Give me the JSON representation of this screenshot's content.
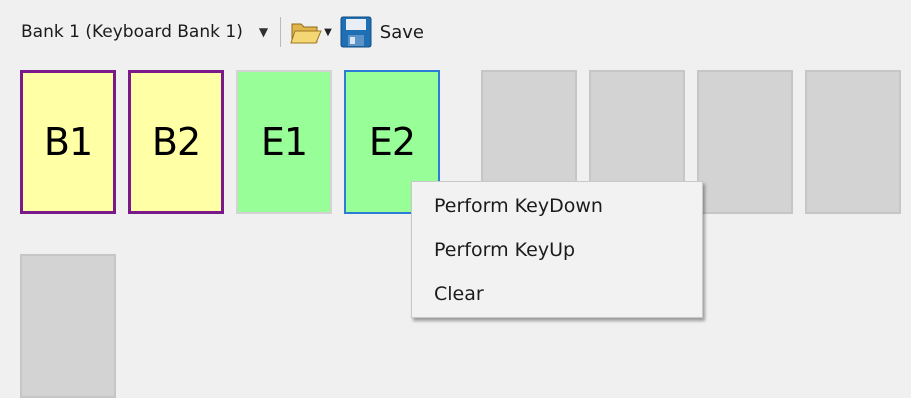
{
  "toolbar": {
    "bank_label": "Bank 1 (Keyboard Bank 1)",
    "save_label": "Save",
    "icons": {
      "open": "folder-open-icon",
      "save": "floppy-disk-icon",
      "dropdown": "chevron-down-icon"
    }
  },
  "keys": [
    {
      "label": "B1",
      "color": "#ffffa6",
      "border": "#7a1a8a"
    },
    {
      "label": "B2",
      "color": "#ffffa6",
      "border": "#7a1a8a"
    },
    {
      "label": "E1",
      "color": "#98ff98",
      "border": "#d3d3d3"
    },
    {
      "label": "E2",
      "color": "#98ff98",
      "border": "#2c7bd6",
      "selected": true
    },
    {
      "label": "",
      "color": "#d3d3d3"
    },
    {
      "label": "",
      "color": "#d3d3d3"
    },
    {
      "label": "",
      "color": "#d3d3d3"
    },
    {
      "label": "",
      "color": "#d3d3d3"
    },
    {
      "label": "",
      "color": "#d3d3d3"
    }
  ],
  "context_menu": {
    "items": [
      {
        "label": "Perform KeyDown"
      },
      {
        "label": "Perform KeyUp"
      },
      {
        "label": "Clear"
      }
    ]
  }
}
